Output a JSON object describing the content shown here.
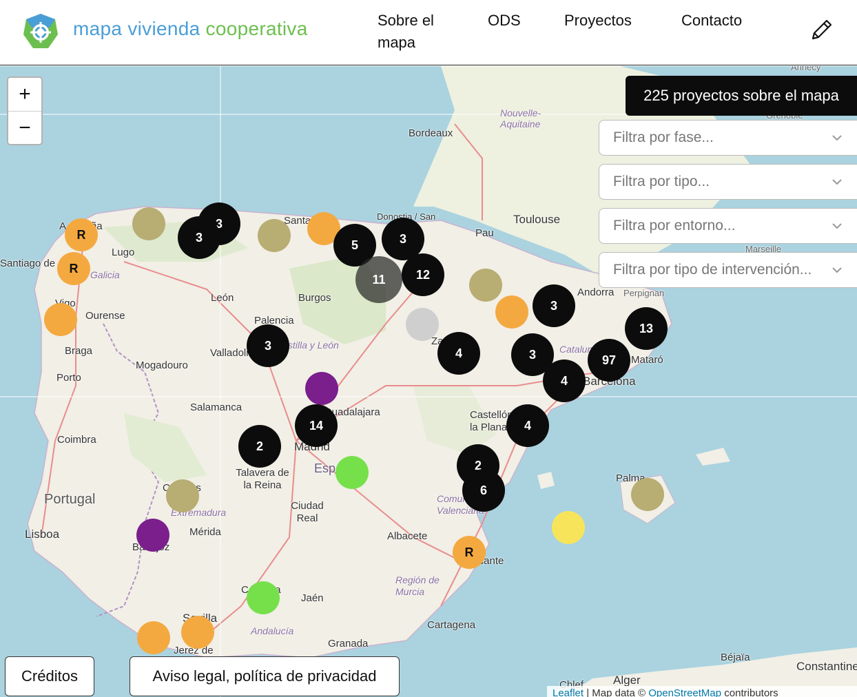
{
  "header": {
    "brand_part1": "mapa vivienda ",
    "brand_part2": "cooperativa",
    "nav": [
      "Sobre el mapa",
      "ODS",
      "Proyectos",
      "Contacto"
    ]
  },
  "map": {
    "zoom_in": "+",
    "zoom_out": "−",
    "project_count": "225 proyectos sobre el mapa",
    "filters": [
      "Filtra por fase...",
      "Filtra por tipo...",
      "Filtra por entorno...",
      "Filtra por tipo de intervención..."
    ],
    "places": [
      "Bordeaux",
      "Toulouse",
      "Pau",
      "Donostia / San Sebastián",
      "Santander",
      "Lugo",
      "Santiago de Compostela",
      "Galicia",
      "Ourense",
      "Vigo",
      "A Coruña",
      "León",
      "Burgos",
      "Palencia",
      "Valladolid",
      "Castilla y León",
      "Braga",
      "Porto",
      "Mogadouro",
      "Salamanca",
      "Guadalajara",
      "Madrid",
      "España",
      "Coimbra",
      "Talavera de la Reina",
      "Portugal",
      "Cáceres",
      "Extremadura",
      "Ciudad Real",
      "Lisboa",
      "Mérida",
      "Badajoz",
      "Albacete",
      "Alicante",
      "Región de Murcia",
      "Córdoba",
      "Jaén",
      "Sevilla",
      "Andalucía",
      "Jerez de",
      "Granada",
      "Cartagena",
      "Zaragoza",
      "Castellón de la Plana",
      "Comunitat Valenciana",
      "Catalunya",
      "Barcelona",
      "Mataró",
      "Andorra",
      "Perpignan",
      "Palma",
      "Marseille",
      "Grenoble",
      "Annecy",
      "Nouvelle-Aquitaine",
      "Béjaïa",
      "Alger",
      "Constantine",
      "Chlef"
    ],
    "clusters": [
      "3",
      "3",
      "5",
      "3",
      "11",
      "12",
      "3",
      "3",
      "13",
      "97",
      "4",
      "3",
      "4",
      "4",
      "14",
      "2",
      "2",
      "6"
    ],
    "dot_labels": [
      "R",
      "R",
      "R"
    ],
    "colors": {
      "orange": "#f4a940",
      "olive": "#b8ad72",
      "purple": "#7a1f8c",
      "green": "#76e04b",
      "grey": "#cfcfcf",
      "yellow": "#f8e45a",
      "cluster": "#0c0c0c"
    }
  },
  "footer": {
    "credits": "Créditos",
    "legal": "Aviso legal, política de privacidad",
    "attribution_leaflet": "Leaflet",
    "attribution_mid": " | Map data © ",
    "attribution_osm": "OpenStreetMap",
    "attribution_end": " contributors"
  }
}
